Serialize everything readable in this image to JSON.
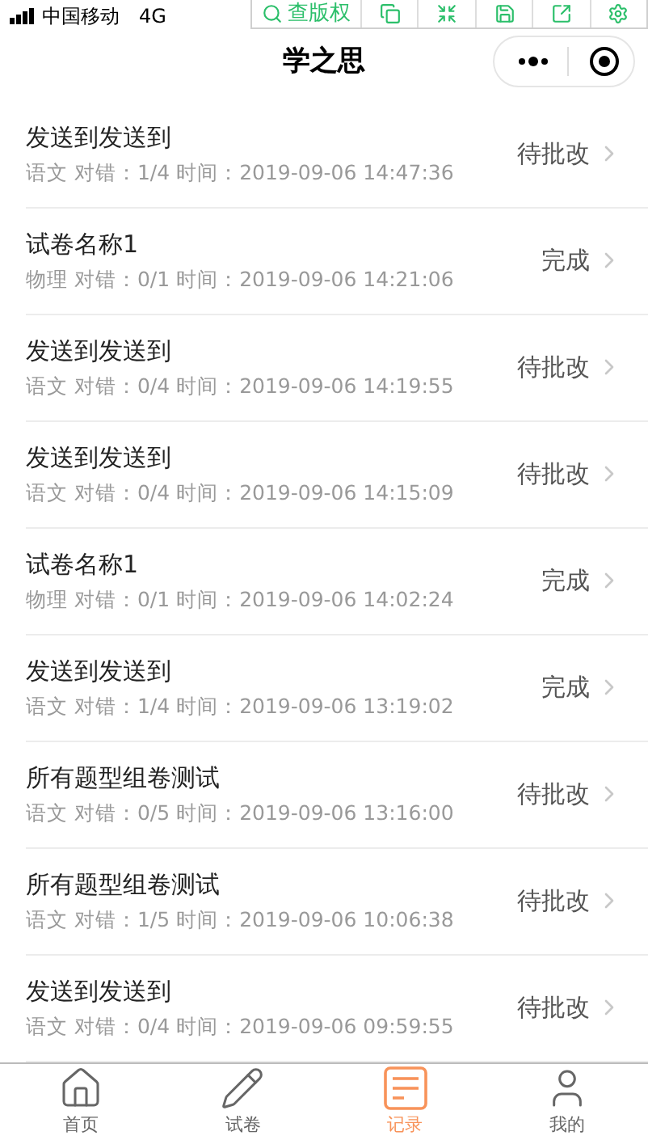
{
  "status_bar": {
    "carrier": "中国移动",
    "network": "4G"
  },
  "overlay_toolbar": {
    "label": "查版权"
  },
  "nav": {
    "title": "学之思"
  },
  "records": [
    {
      "title": "发送到发送到",
      "meta": "语文 对错：1/4 时间：2019-09-06 14:47:36",
      "status": "待批改"
    },
    {
      "title": "试卷名称1",
      "meta": "物理 对错：0/1 时间：2019-09-06 14:21:06",
      "status": "完成"
    },
    {
      "title": "发送到发送到",
      "meta": "语文 对错：0/4 时间：2019-09-06 14:19:55",
      "status": "待批改"
    },
    {
      "title": "发送到发送到",
      "meta": "语文 对错：0/4 时间：2019-09-06 14:15:09",
      "status": "待批改"
    },
    {
      "title": "试卷名称1",
      "meta": "物理 对错：0/1 时间：2019-09-06 14:02:24",
      "status": "完成"
    },
    {
      "title": "发送到发送到",
      "meta": "语文 对错：1/4 时间：2019-09-06 13:19:02",
      "status": "完成"
    },
    {
      "title": "所有题型组卷测试",
      "meta": "语文 对错：0/5 时间：2019-09-06 13:16:00",
      "status": "待批改"
    },
    {
      "title": "所有题型组卷测试",
      "meta": "语文 对错：1/5 时间：2019-09-06 10:06:38",
      "status": "待批改"
    },
    {
      "title": "发送到发送到",
      "meta": "语文 对错：0/4 时间：2019-09-06 09:59:55",
      "status": "待批改"
    }
  ],
  "tabs": [
    {
      "kind": "home",
      "label": "首页",
      "selected": false
    },
    {
      "kind": "paper",
      "label": "试卷",
      "selected": false
    },
    {
      "kind": "record",
      "label": "记录",
      "selected": true
    },
    {
      "kind": "profile",
      "label": "我的",
      "selected": false
    }
  ]
}
